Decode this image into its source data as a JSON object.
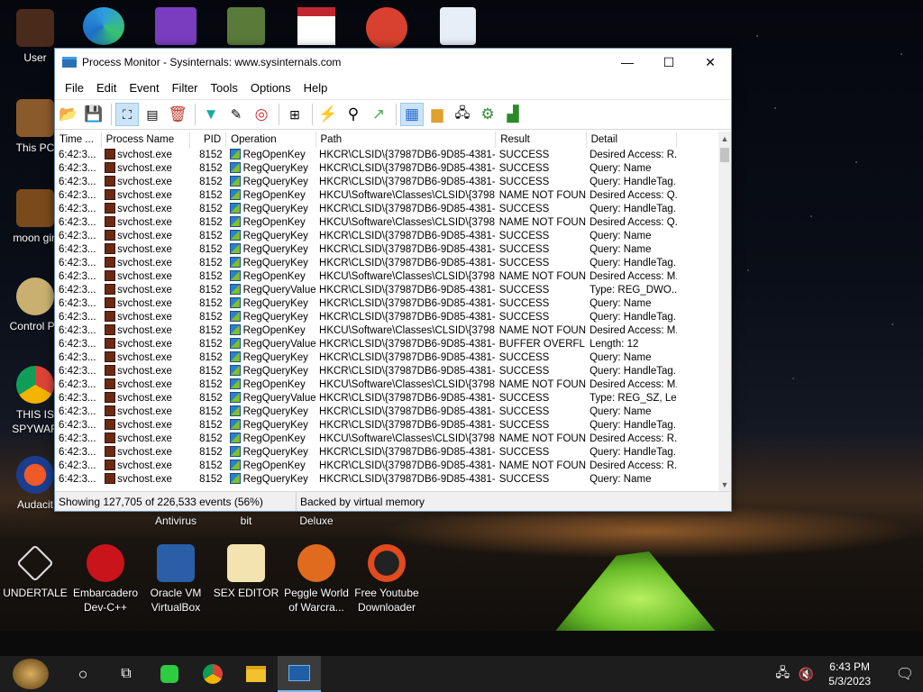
{
  "desktop": {
    "icons_left": [
      {
        "label": "User"
      },
      {
        "label": "This PC"
      },
      {
        "label": "moon gin"
      },
      {
        "label": "Control Pa"
      },
      {
        "label": "THIS IS SPYWAR"
      },
      {
        "label": "Audacit"
      }
    ],
    "partial_labels": [
      "Antivirus",
      "bit",
      "Deluxe"
    ],
    "icons_bottom": [
      {
        "label": "UNDERTALE"
      },
      {
        "label": "Embarcadero Dev-C++"
      },
      {
        "label": "Oracle VM VirtualBox"
      },
      {
        "label": "SEX EDITOR"
      },
      {
        "label": "Peggle World of Warcra..."
      },
      {
        "label": "Free Youtube Downloader"
      }
    ]
  },
  "window": {
    "title": "Process Monitor - Sysinternals: www.sysinternals.com",
    "controls": {
      "minimize": "—",
      "maximize": "☐",
      "close": "✕"
    },
    "menu": [
      "File",
      "Edit",
      "Event",
      "Filter",
      "Tools",
      "Options",
      "Help"
    ],
    "columns": [
      "Time ...",
      "Process Name",
      "PID",
      "Operation",
      "Path",
      "Result",
      "Detail"
    ],
    "rows": [
      [
        "6:42:3...",
        "svchost.exe",
        "8152",
        "RegOpenKey",
        "HKCR\\CLSID\\{37987DB6-9D85-4381-8...",
        "SUCCESS",
        "Desired Access: R..."
      ],
      [
        "6:42:3...",
        "svchost.exe",
        "8152",
        "RegQueryKey",
        "HKCR\\CLSID\\{37987DB6-9D85-4381-8...",
        "SUCCESS",
        "Query: Name"
      ],
      [
        "6:42:3...",
        "svchost.exe",
        "8152",
        "RegQueryKey",
        "HKCR\\CLSID\\{37987DB6-9D85-4381-8...",
        "SUCCESS",
        "Query: HandleTag..."
      ],
      [
        "6:42:3...",
        "svchost.exe",
        "8152",
        "RegOpenKey",
        "HKCU\\Software\\Classes\\CLSID\\{3798...",
        "NAME NOT FOUND",
        "Desired Access: Q..."
      ],
      [
        "6:42:3...",
        "svchost.exe",
        "8152",
        "RegQueryKey",
        "HKCR\\CLSID\\{37987DB6-9D85-4381-8...",
        "SUCCESS",
        "Query: HandleTag..."
      ],
      [
        "6:42:3...",
        "svchost.exe",
        "8152",
        "RegOpenKey",
        "HKCU\\Software\\Classes\\CLSID\\{3798...",
        "NAME NOT FOUND",
        "Desired Access: Q..."
      ],
      [
        "6:42:3...",
        "svchost.exe",
        "8152",
        "RegQueryKey",
        "HKCR\\CLSID\\{37987DB6-9D85-4381-8...",
        "SUCCESS",
        "Query: Name"
      ],
      [
        "6:42:3...",
        "svchost.exe",
        "8152",
        "RegQueryKey",
        "HKCR\\CLSID\\{37987DB6-9D85-4381-8...",
        "SUCCESS",
        "Query: Name"
      ],
      [
        "6:42:3...",
        "svchost.exe",
        "8152",
        "RegQueryKey",
        "HKCR\\CLSID\\{37987DB6-9D85-4381-8...",
        "SUCCESS",
        "Query: HandleTag..."
      ],
      [
        "6:42:3...",
        "svchost.exe",
        "8152",
        "RegOpenKey",
        "HKCU\\Software\\Classes\\CLSID\\{3798...",
        "NAME NOT FOUND",
        "Desired Access: M..."
      ],
      [
        "6:42:3...",
        "svchost.exe",
        "8152",
        "RegQueryValue",
        "HKCR\\CLSID\\{37987DB6-9D85-4381-8...",
        "SUCCESS",
        "Type: REG_DWO..."
      ],
      [
        "6:42:3...",
        "svchost.exe",
        "8152",
        "RegQueryKey",
        "HKCR\\CLSID\\{37987DB6-9D85-4381-8...",
        "SUCCESS",
        "Query: Name"
      ],
      [
        "6:42:3...",
        "svchost.exe",
        "8152",
        "RegQueryKey",
        "HKCR\\CLSID\\{37987DB6-9D85-4381-8...",
        "SUCCESS",
        "Query: HandleTag..."
      ],
      [
        "6:42:3...",
        "svchost.exe",
        "8152",
        "RegOpenKey",
        "HKCU\\Software\\Classes\\CLSID\\{3798...",
        "NAME NOT FOUND",
        "Desired Access: M..."
      ],
      [
        "6:42:3...",
        "svchost.exe",
        "8152",
        "RegQueryValue",
        "HKCR\\CLSID\\{37987DB6-9D85-4381-8...",
        "BUFFER OVERFL...",
        "Length: 12"
      ],
      [
        "6:42:3...",
        "svchost.exe",
        "8152",
        "RegQueryKey",
        "HKCR\\CLSID\\{37987DB6-9D85-4381-8...",
        "SUCCESS",
        "Query: Name"
      ],
      [
        "6:42:3...",
        "svchost.exe",
        "8152",
        "RegQueryKey",
        "HKCR\\CLSID\\{37987DB6-9D85-4381-8...",
        "SUCCESS",
        "Query: HandleTag..."
      ],
      [
        "6:42:3...",
        "svchost.exe",
        "8152",
        "RegOpenKey",
        "HKCU\\Software\\Classes\\CLSID\\{3798...",
        "NAME NOT FOUND",
        "Desired Access: M..."
      ],
      [
        "6:42:3...",
        "svchost.exe",
        "8152",
        "RegQueryValue",
        "HKCR\\CLSID\\{37987DB6-9D85-4381-8...",
        "SUCCESS",
        "Type: REG_SZ, Le..."
      ],
      [
        "6:42:3...",
        "svchost.exe",
        "8152",
        "RegQueryKey",
        "HKCR\\CLSID\\{37987DB6-9D85-4381-8...",
        "SUCCESS",
        "Query: Name"
      ],
      [
        "6:42:3...",
        "svchost.exe",
        "8152",
        "RegQueryKey",
        "HKCR\\CLSID\\{37987DB6-9D85-4381-8...",
        "SUCCESS",
        "Query: HandleTag..."
      ],
      [
        "6:42:3...",
        "svchost.exe",
        "8152",
        "RegOpenKey",
        "HKCU\\Software\\Classes\\CLSID\\{3798...",
        "NAME NOT FOUND",
        "Desired Access: R..."
      ],
      [
        "6:42:3...",
        "svchost.exe",
        "8152",
        "RegQueryKey",
        "HKCR\\CLSID\\{37987DB6-9D85-4381-8...",
        "SUCCESS",
        "Query: HandleTag..."
      ],
      [
        "6:42:3...",
        "svchost.exe",
        "8152",
        "RegOpenKey",
        "HKCR\\CLSID\\{37987DB6-9D85-4381-8...",
        "NAME NOT FOUND",
        "Desired Access: R..."
      ],
      [
        "6:42:3...",
        "svchost.exe",
        "8152",
        "RegQueryKey",
        "HKCR\\CLSID\\{37987DB6-9D85-4381-8...",
        "SUCCESS",
        "Query: Name"
      ]
    ],
    "status": {
      "events": "Showing 127,705 of 226,533 events (56%)",
      "memory": "Backed by virtual memory"
    }
  },
  "taskbar": {
    "clock_time": "6:43 PM",
    "clock_date": "5/3/2023"
  }
}
